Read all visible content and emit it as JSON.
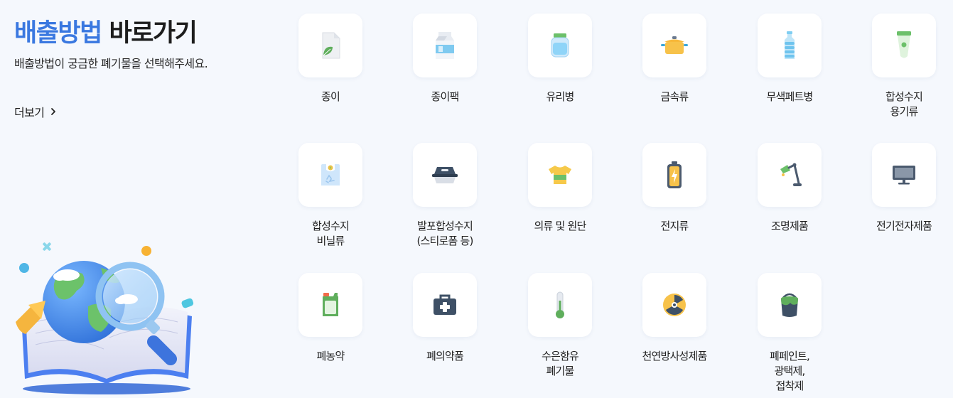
{
  "header": {
    "title_accent": "배출방법",
    "title_rest": " 바로가기",
    "subtitle": "배출방법이 궁금한 폐기물을 선택해주세요.",
    "more_label": "더보기",
    "more_icon": "chevron-right-icon"
  },
  "colors": {
    "accent": "#3a78e0",
    "background": "#f5f8fd",
    "card": "#ffffff"
  },
  "categories": [
    {
      "label": "종이",
      "icon": "paper-icon"
    },
    {
      "label": "종이팩",
      "icon": "milk-carton-icon"
    },
    {
      "label": "유리병",
      "icon": "glass-jar-icon"
    },
    {
      "label": "금속류",
      "icon": "metal-pot-icon"
    },
    {
      "label": "무색페트병",
      "icon": "pet-bottle-icon"
    },
    {
      "label": "합성수지\n용기류",
      "icon": "plastic-tube-icon"
    },
    {
      "label": "합성수지\n비닐류",
      "icon": "plastic-bag-icon"
    },
    {
      "label": "발포합성수지\n(스티로폼 등)",
      "icon": "styrofoam-box-icon"
    },
    {
      "label": "의류 및 원단",
      "icon": "tshirt-icon"
    },
    {
      "label": "전지류",
      "icon": "battery-icon"
    },
    {
      "label": "조명제품",
      "icon": "desk-lamp-icon"
    },
    {
      "label": "전기전자제품",
      "icon": "monitor-icon"
    },
    {
      "label": "폐농약",
      "icon": "pesticide-bottle-icon"
    },
    {
      "label": "폐의약품",
      "icon": "medicine-kit-icon"
    },
    {
      "label": "수은함유\n폐기물",
      "icon": "thermometer-icon"
    },
    {
      "label": "천연방사성제품",
      "icon": "radiation-icon"
    },
    {
      "label": "폐페인트,\n광택제,\n접착제",
      "icon": "paint-bucket-icon"
    }
  ]
}
